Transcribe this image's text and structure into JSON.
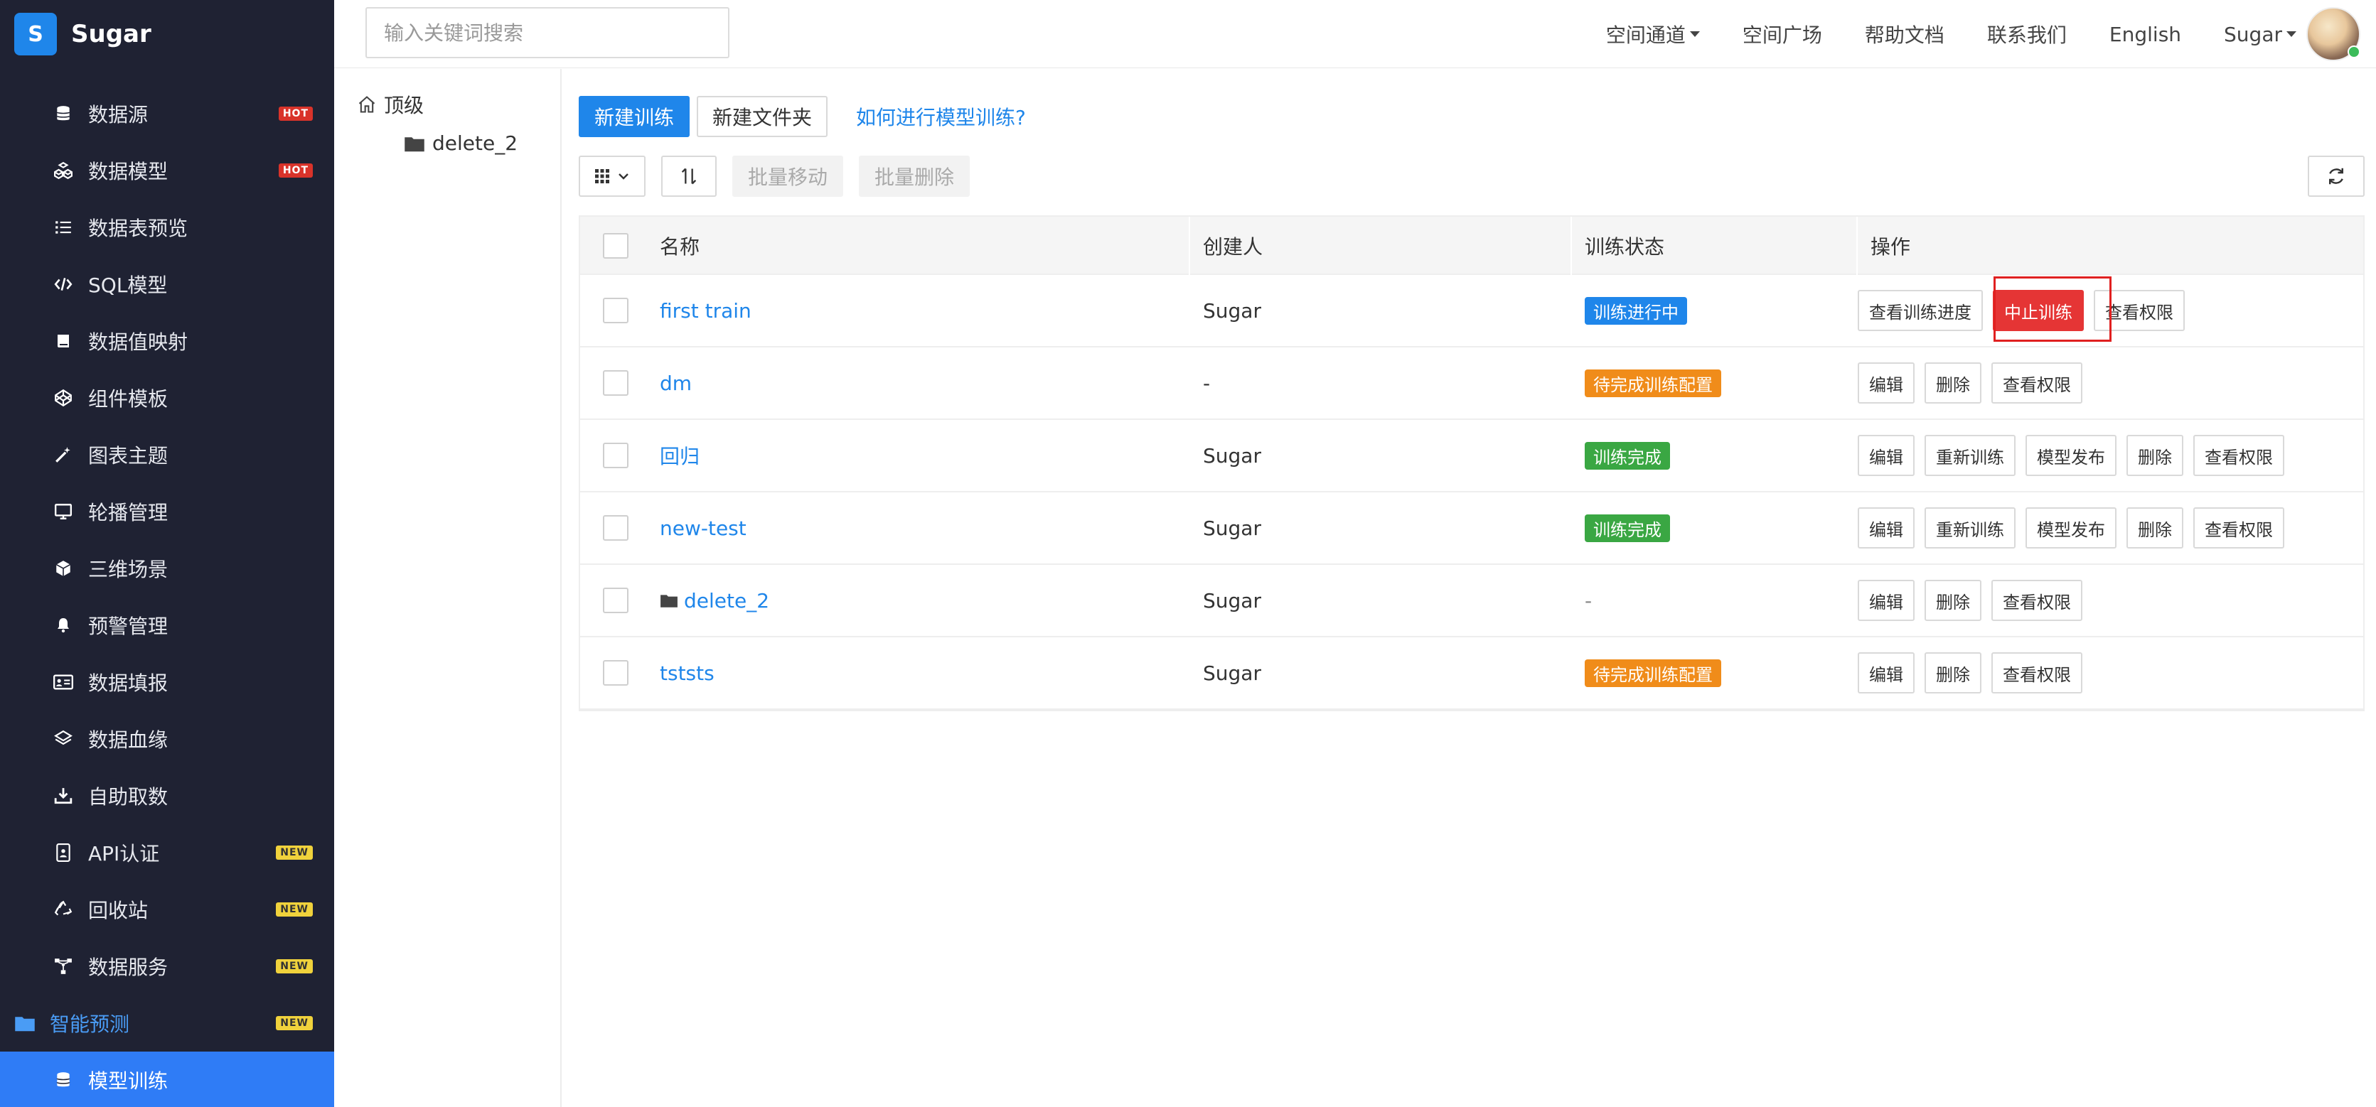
{
  "brand": {
    "logo_letter": "S",
    "name": "Sugar"
  },
  "sidebar": {
    "items": [
      {
        "label": "数据源",
        "icon": "database-icon",
        "badge": "HOT"
      },
      {
        "label": "数据模型",
        "icon": "cubes-icon",
        "badge": "HOT"
      },
      {
        "label": "数据表预览",
        "icon": "list-icon",
        "badge": ""
      },
      {
        "label": "SQL模型",
        "icon": "code-icon",
        "badge": ""
      },
      {
        "label": "数据值映射",
        "icon": "book-icon",
        "badge": ""
      },
      {
        "label": "组件模板",
        "icon": "codepen-icon",
        "badge": ""
      },
      {
        "label": "图表主题",
        "icon": "magic-wand-icon",
        "badge": ""
      },
      {
        "label": "轮播管理",
        "icon": "monitor-icon",
        "badge": ""
      },
      {
        "label": "三维场景",
        "icon": "cube-icon",
        "badge": ""
      },
      {
        "label": "预警管理",
        "icon": "bell-icon",
        "badge": ""
      },
      {
        "label": "数据填报",
        "icon": "id-card-icon",
        "badge": ""
      },
      {
        "label": "数据血缘",
        "icon": "layers-icon",
        "badge": ""
      },
      {
        "label": "自助取数",
        "icon": "download-icon",
        "badge": ""
      },
      {
        "label": "API认证",
        "icon": "id-badge-icon",
        "badge": "NEW"
      },
      {
        "label": "回收站",
        "icon": "recycle-icon",
        "badge": "NEW"
      },
      {
        "label": "数据服务",
        "icon": "network-icon",
        "badge": "NEW"
      }
    ],
    "group": {
      "label": "智能预测",
      "icon": "folder-icon",
      "badge": "NEW"
    },
    "active": {
      "label": "模型训练",
      "icon": "database-icon"
    }
  },
  "topbar": {
    "search_placeholder": "输入关键词搜索",
    "nav": [
      "空间通道",
      "空间广场",
      "帮助文档",
      "联系我们",
      "English",
      "Sugar"
    ]
  },
  "tree": {
    "root": "顶级",
    "child": "delete_2"
  },
  "toolbar": {
    "new_training": "新建训练",
    "new_folder": "新建文件夹",
    "help_link": "如何进行模型训练?",
    "batch_move": "批量移动",
    "batch_delete": "批量删除"
  },
  "table": {
    "headers": [
      "名称",
      "创建人",
      "训练状态",
      "操作"
    ],
    "rows": [
      {
        "name": "first train",
        "creator": "Sugar",
        "status": "训练进行中",
        "status_color": "#1f86ea",
        "actions": [
          "查看训练进度",
          "中止训练",
          "查看权限"
        ]
      },
      {
        "name": "dm",
        "creator": "-",
        "status": "待完成训练配置",
        "status_color": "#f08c1a",
        "actions": [
          "编辑",
          "删除",
          "查看权限"
        ]
      },
      {
        "name": "回归",
        "creator": "Sugar",
        "status": "训练完成",
        "status_color": "#3aa743",
        "actions": [
          "编辑",
          "重新训练",
          "模型发布",
          "删除",
          "查看权限"
        ]
      },
      {
        "name": "new-test",
        "creator": "Sugar",
        "status": "训练完成",
        "status_color": "#3aa743",
        "actions": [
          "编辑",
          "重新训练",
          "模型发布",
          "删除",
          "查看权限"
        ]
      },
      {
        "name": "delete_2",
        "creator": "Sugar",
        "status": "-",
        "status_color": "",
        "actions": [
          "编辑",
          "删除",
          "查看权限"
        ],
        "is_folder": true
      },
      {
        "name": "tststs",
        "creator": "Sugar",
        "status": "待完成训练配置",
        "status_color": "#f08c1a",
        "actions": [
          "编辑",
          "删除",
          "查看权限"
        ]
      }
    ]
  },
  "colors": {
    "sidebar_bg": "#1f2233",
    "accent": "#1f86ea",
    "active_bg": "#2f7cf6",
    "danger": "#e53535"
  }
}
